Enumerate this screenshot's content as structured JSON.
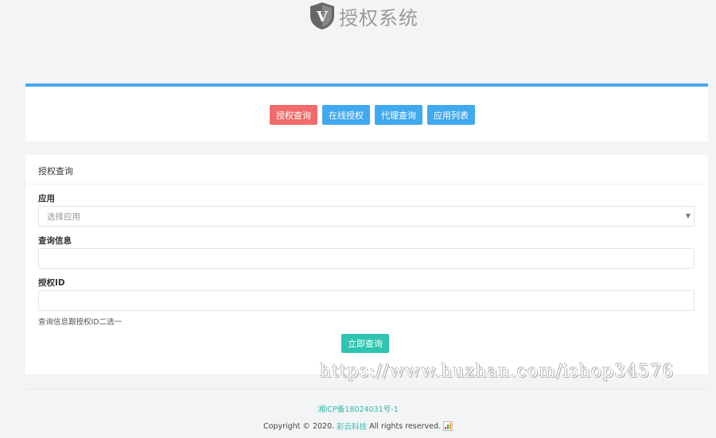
{
  "header": {
    "logo_letter": "V",
    "title": "授权系统"
  },
  "nav": {
    "buttons": [
      {
        "label": "授权查询",
        "active": true
      },
      {
        "label": "在线授权",
        "active": false
      },
      {
        "label": "代理查询",
        "active": false
      },
      {
        "label": "应用列表",
        "active": false
      }
    ]
  },
  "query": {
    "title": "授权查询",
    "app_label": "应用",
    "app_select_value": "选择应用",
    "info_label": "查询信息",
    "info_value": "",
    "auth_id_label": "授权ID",
    "auth_id_value": "",
    "help_text": "查询信息跟授权ID二选一",
    "submit_label": "立即查询"
  },
  "watermark": "https://www.huzhan.com/ishop34576",
  "footer": {
    "icp": "湘ICP备18024031号-1",
    "copyright_prefix": "Copyright © 2020.",
    "brand": "彩云科技",
    "copyright_suffix": "All rights reserved."
  },
  "colors": {
    "accent": "#4aa8ee",
    "active_tab": "#f26b6b",
    "submit": "#2fc4b0"
  }
}
